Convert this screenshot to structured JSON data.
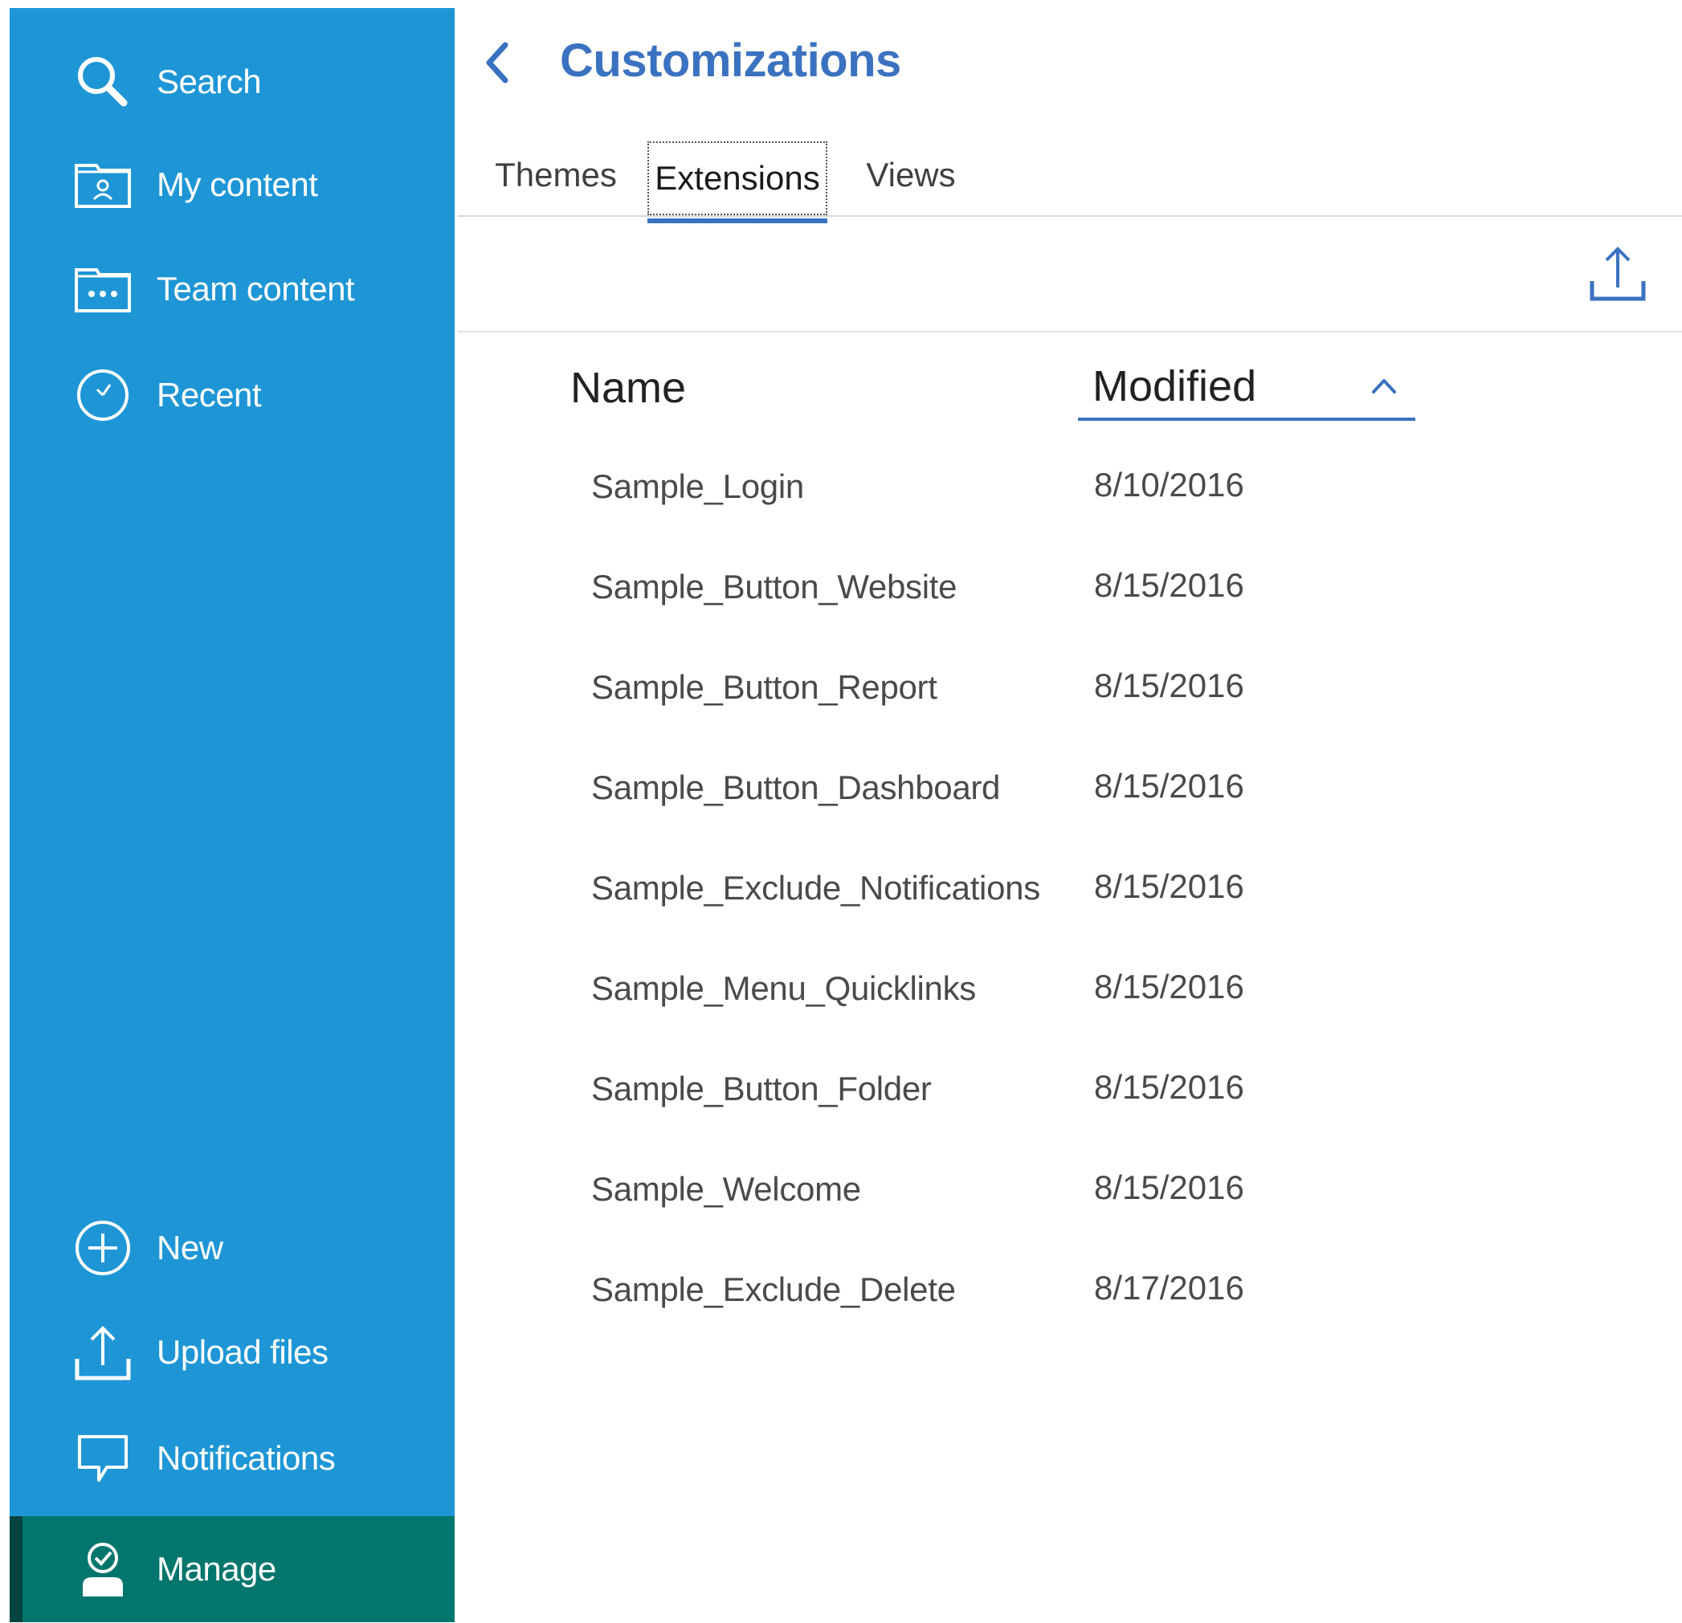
{
  "sidebar": {
    "top_items": [
      {
        "label": "Search",
        "icon": "search-icon"
      },
      {
        "label": "My content",
        "icon": "my-content-folder-icon"
      },
      {
        "label": "Team content",
        "icon": "team-content-folder-icon"
      },
      {
        "label": "Recent",
        "icon": "clock-icon"
      }
    ],
    "bottom_items": [
      {
        "label": "New",
        "icon": "plus-circle-icon"
      },
      {
        "label": "Upload files",
        "icon": "upload-icon"
      },
      {
        "label": "Notifications",
        "icon": "speech-bubble-icon"
      },
      {
        "label": "Manage",
        "icon": "manage-user-check-icon",
        "active": true
      }
    ]
  },
  "header": {
    "title": "Customizations",
    "back_icon": "chevron-left-icon"
  },
  "tabs": [
    {
      "label": "Themes",
      "selected": false
    },
    {
      "label": "Extensions",
      "selected": true
    },
    {
      "label": "Views",
      "selected": false
    }
  ],
  "toolbar": {
    "upload_icon": "upload-icon"
  },
  "table": {
    "columns": {
      "name": "Name",
      "modified": "Modified",
      "sort_icon": "chevron-up-icon"
    },
    "rows": [
      {
        "name": "Sample_Login",
        "modified": "8/10/2016"
      },
      {
        "name": "Sample_Button_Website",
        "modified": "8/15/2016"
      },
      {
        "name": "Sample_Button_Report",
        "modified": "8/15/2016"
      },
      {
        "name": "Sample_Button_Dashboard",
        "modified": "8/15/2016"
      },
      {
        "name": "Sample_Exclude_Notifications",
        "modified": "8/15/2016"
      },
      {
        "name": "Sample_Menu_Quicklinks",
        "modified": "8/15/2016"
      },
      {
        "name": "Sample_Button_Folder",
        "modified": "8/15/2016"
      },
      {
        "name": "Sample_Welcome",
        "modified": "8/15/2016"
      },
      {
        "name": "Sample_Exclude_Delete",
        "modified": "8/17/2016"
      }
    ]
  },
  "colors": {
    "sidebar_bg": "#1e96d6",
    "sidebar_active_bg": "#02766d",
    "accent": "#3b72c0",
    "text": "#4a4a4a"
  }
}
